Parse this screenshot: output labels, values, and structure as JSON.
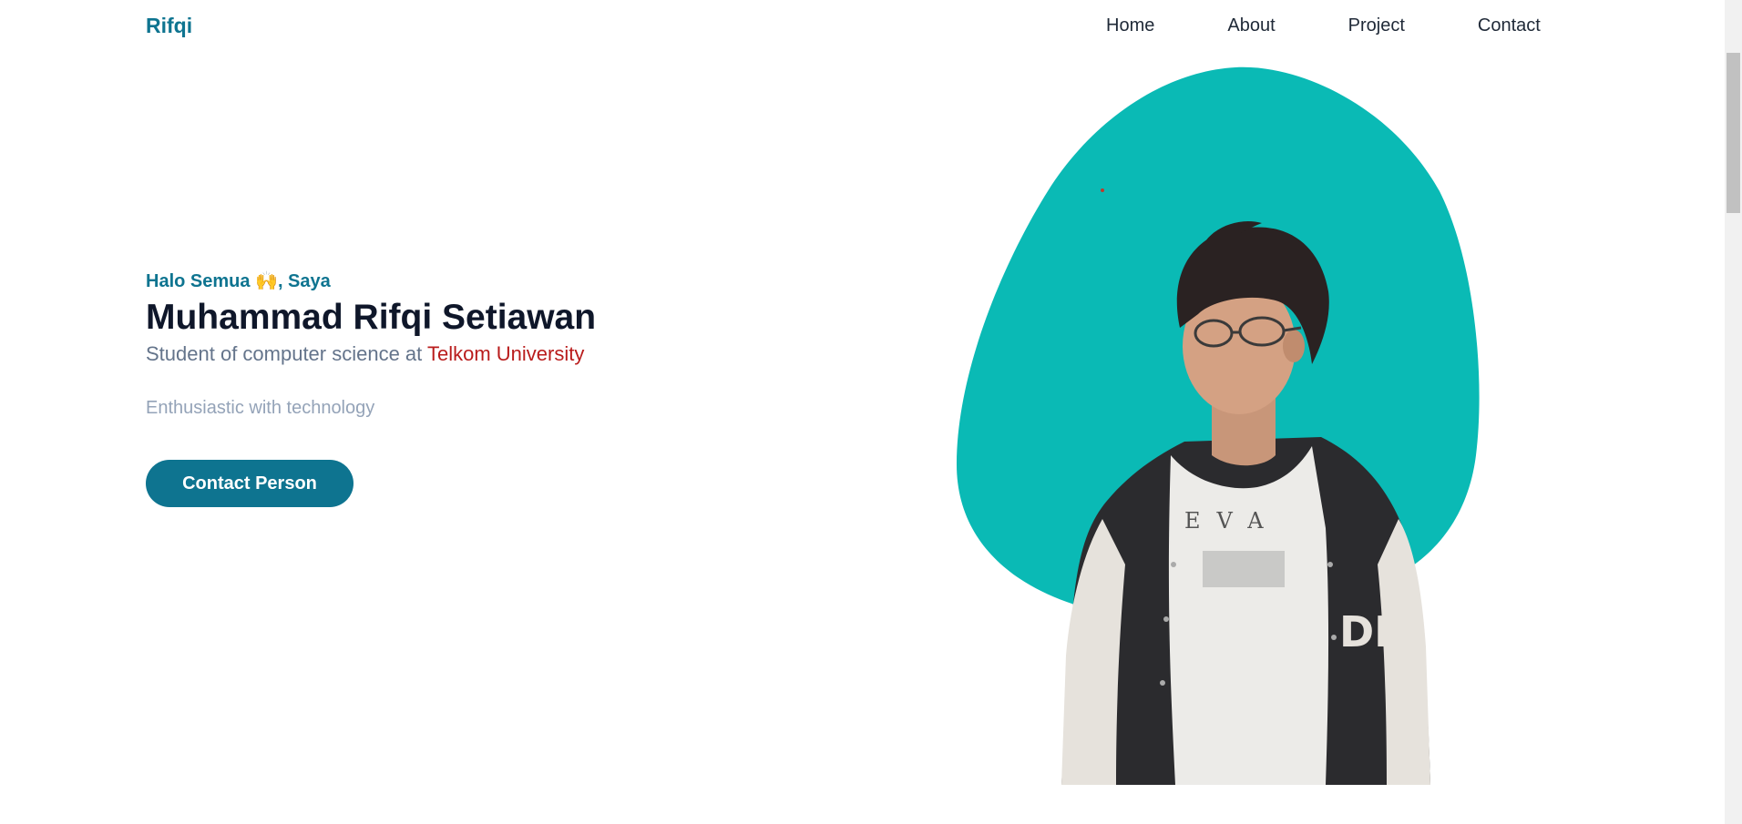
{
  "header": {
    "brand": "Rifqi",
    "nav": [
      "Home",
      "About",
      "Project",
      "Contact"
    ]
  },
  "hero": {
    "greeting": "Halo Semua 🙌, Saya",
    "name": "Muhammad Rifqi Setiawan",
    "subtitle_prefix": "Student of computer science at ",
    "university": "Telkom University",
    "tagline": "Enthusiastic with technology",
    "cta_label": "Contact Person"
  },
  "colors": {
    "accent": "#0e7490",
    "blob": "#0abab5",
    "university": "#b91c1c",
    "heading": "#0f172a"
  }
}
